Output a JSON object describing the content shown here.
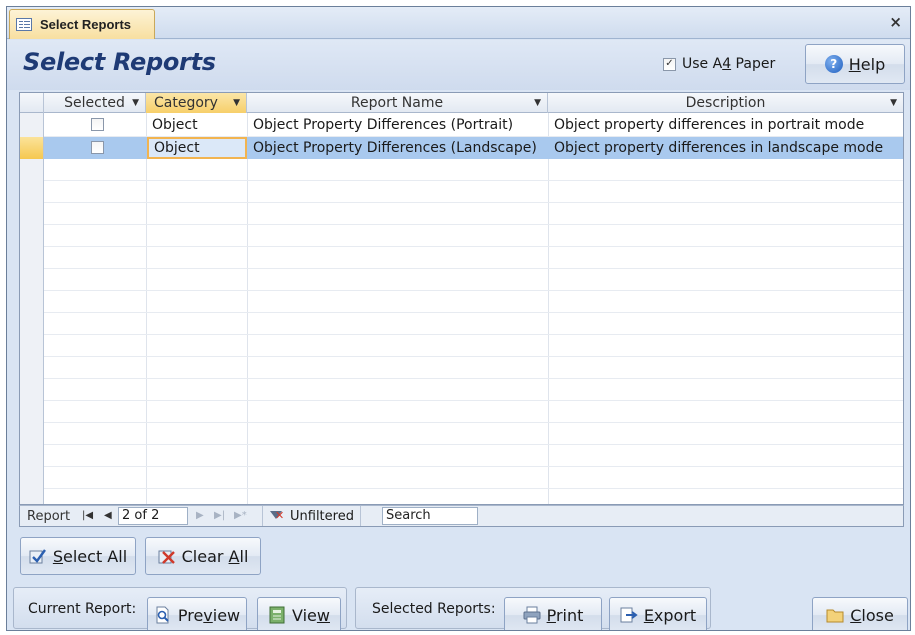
{
  "window": {
    "tab_title": "Select Reports",
    "close_glyph": "×"
  },
  "header": {
    "title": "Select Reports",
    "a4_label_pre": "Use A",
    "a4_label_u": "4",
    "a4_label_post": " Paper",
    "a4_checked": true,
    "help_u": "H",
    "help_rest": "elp"
  },
  "grid": {
    "columns": [
      {
        "label": "Selected"
      },
      {
        "label": "Category"
      },
      {
        "label": "Report Name"
      },
      {
        "label": "Description"
      }
    ],
    "rows": [
      {
        "selected": false,
        "category": "Object",
        "report_name": "Object Property Differences (Portrait)",
        "description": "Object property differences in portrait mode"
      },
      {
        "selected": false,
        "category": "Object",
        "report_name": "Object Property Differences (Landscape)",
        "description": "Object property differences in landscape mode"
      }
    ],
    "selected_row_index": 1
  },
  "navbar": {
    "record_label": "Report",
    "record_value": "2 of 2",
    "filter_label": "Unfiltered",
    "search_value": "Search"
  },
  "actions": {
    "select_all_u": "S",
    "select_all_rest": "elect All",
    "clear_all_pre": "Clear ",
    "clear_all_u": "A",
    "clear_all_post": "ll"
  },
  "footer": {
    "current_report_label": "Current Report:",
    "preview_pre": "Pre",
    "preview_u": "v",
    "preview_post": "iew",
    "view_pre": "Vie",
    "view_u": "w",
    "selected_reports_label": "Selected Reports:",
    "print_u": "P",
    "print_rest": "rint",
    "export_u": "E",
    "export_rest": "xport",
    "close_u": "C",
    "close_rest": "lose"
  },
  "colors": {
    "title_blue": "#1e3a75",
    "selected_row": "#a9c9ee",
    "active_header": "#f7cf6a"
  }
}
